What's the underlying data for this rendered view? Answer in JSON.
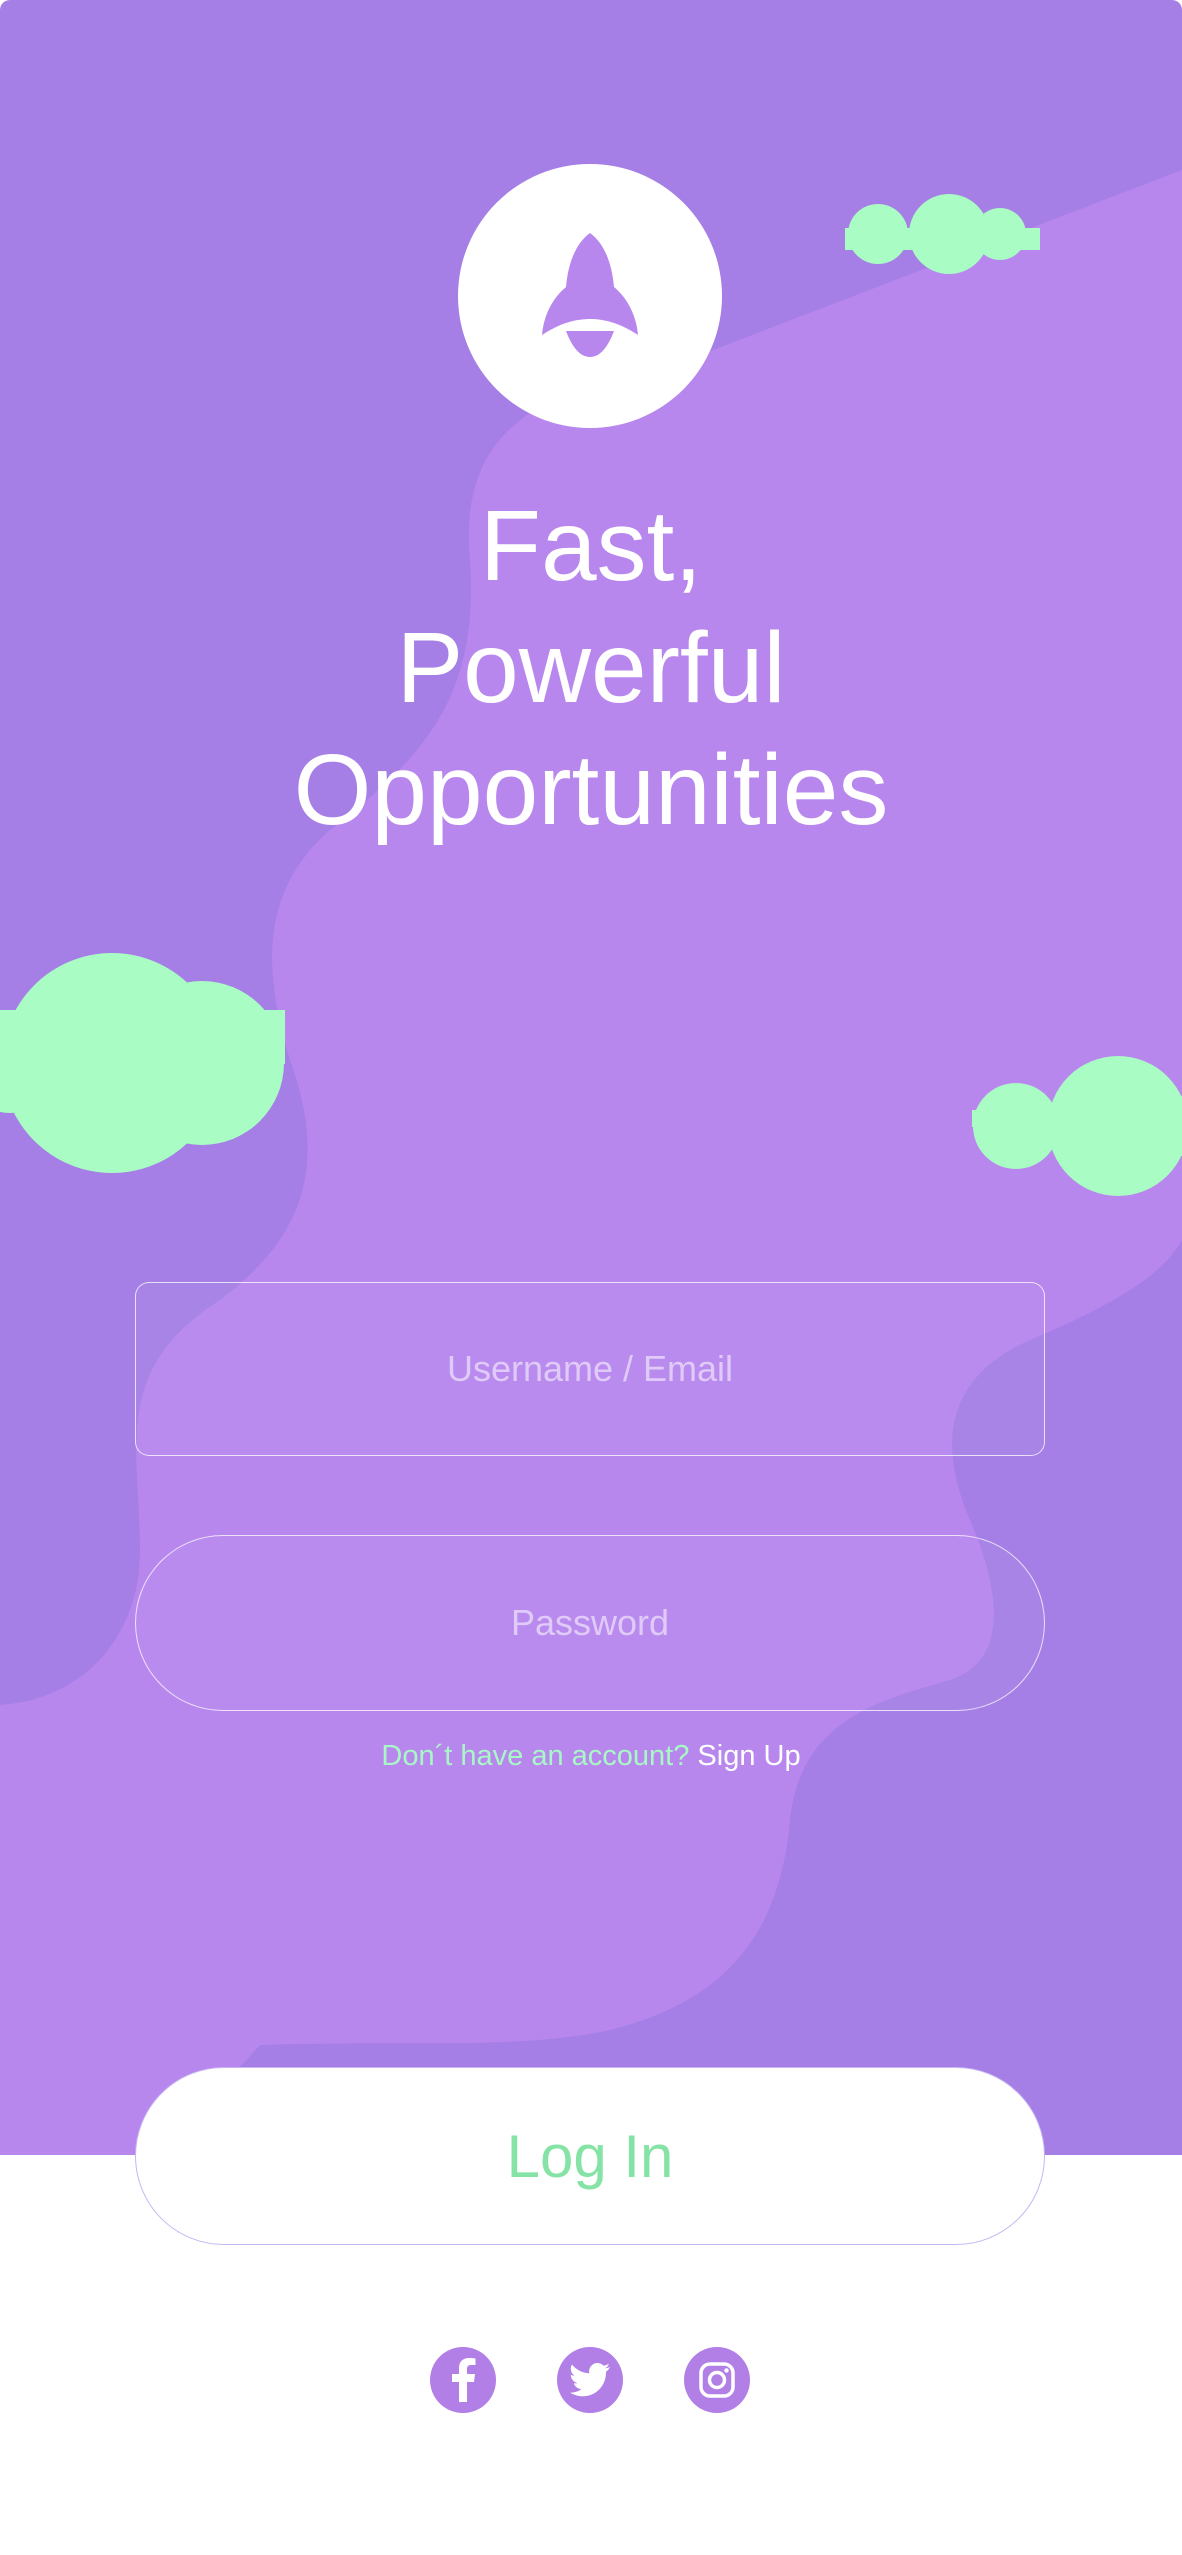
{
  "colors": {
    "hero_base": "#a57fe6",
    "hero_wave": "#b887ee",
    "cloud": "#a8fcc4",
    "login_text": "#86e3a6",
    "white": "#ffffff"
  },
  "brand": {
    "logo_icon": "rocket-icon"
  },
  "headline": {
    "line1": "Fast,",
    "line2": "Powerful",
    "line3": "Opportunities"
  },
  "form": {
    "username_placeholder": "Username / Email",
    "password_placeholder": "Password"
  },
  "signup": {
    "question": "Don´t have  an account?",
    "link": "Sign Up"
  },
  "login": {
    "label": "Log In"
  },
  "social": [
    {
      "icon": "facebook-icon"
    },
    {
      "icon": "twitter-icon"
    },
    {
      "icon": "instagram-icon"
    }
  ]
}
